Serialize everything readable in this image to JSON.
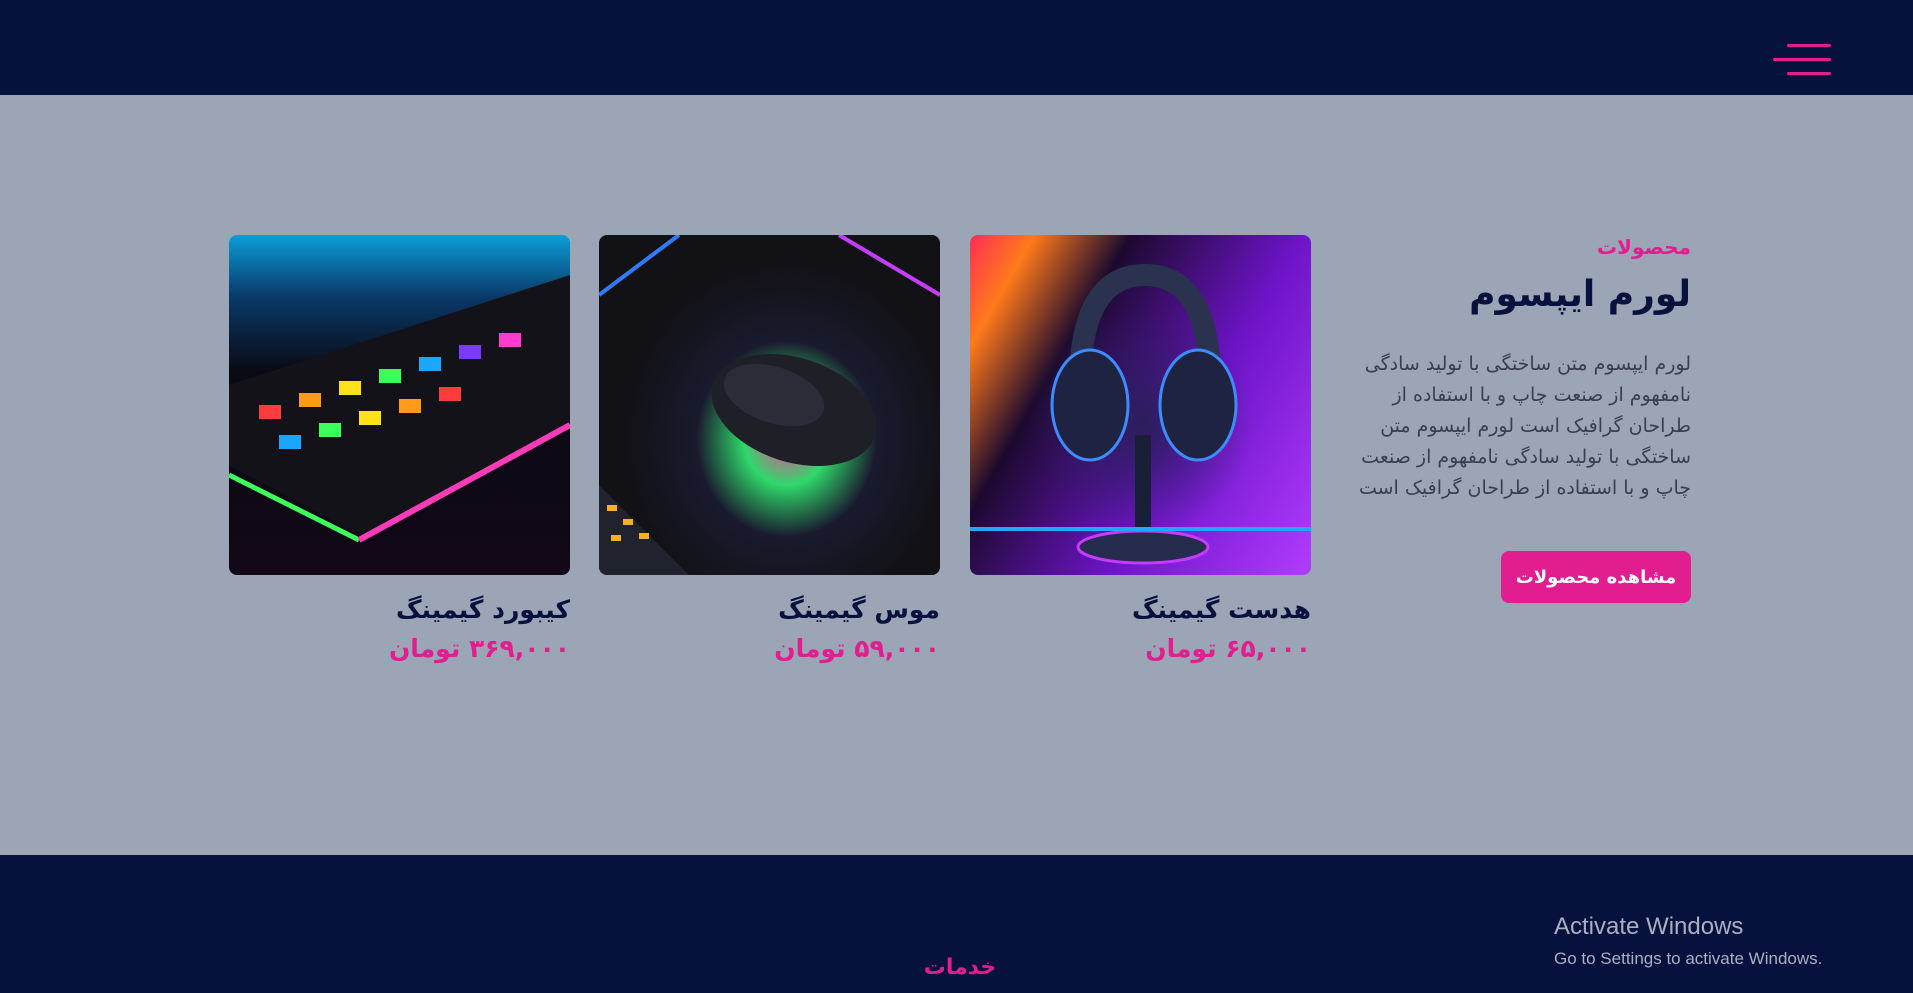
{
  "header": {
    "menu_icon": "hamburger-menu-icon"
  },
  "intro": {
    "eyebrow": "محصولات",
    "title": "لورم ایپسوم",
    "description": "لورم ایپسوم متن ساختگی با تولید سادگی نامفهوم از صنعت چاپ و با استفاده از طراحان گرافیک است لورم ایپسوم متن ساختگی با تولید سادگی نامفهوم از صنعت چاپ و با استفاده از طراحان گرافیک است",
    "cta_label": "مشاهده محصولات"
  },
  "products": [
    {
      "name": "هدست گیمینگ",
      "price": "۶۵,۰۰۰ تومان",
      "image": "gaming-headset-image"
    },
    {
      "name": "موس گیمینگ",
      "price": "۵۹,۰۰۰ تومان",
      "image": "gaming-mouse-image"
    },
    {
      "name": "کیبورد گیمینگ",
      "price": "۳۶۹,۰۰۰ تومان",
      "image": "gaming-keyboard-image"
    }
  ],
  "footer": {
    "services_label": "خدمات"
  },
  "os_watermark": {
    "title": "Activate Windows",
    "subtitle": "Go to Settings to activate Windows."
  },
  "colors": {
    "navy": "#06113d",
    "pink": "#e21d8f",
    "page_bg": "#9ba5b5"
  }
}
